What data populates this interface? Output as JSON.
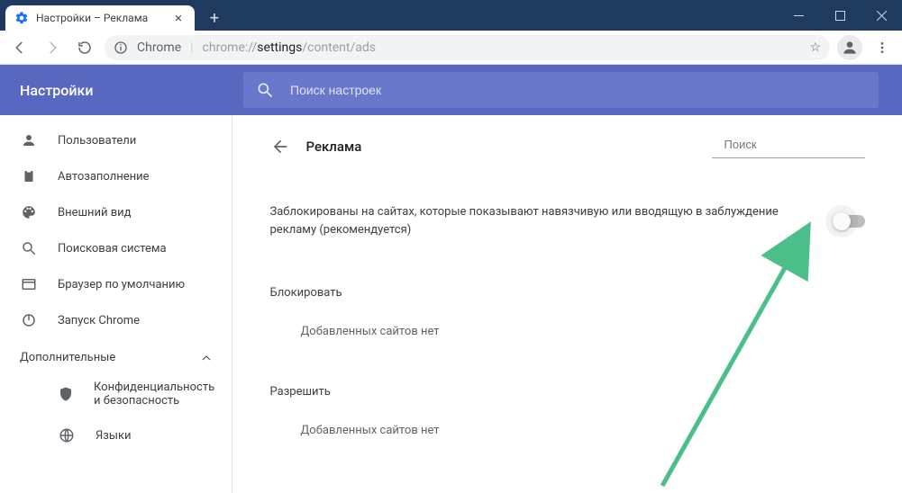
{
  "window": {
    "tab_title": "Настройки – Реклама"
  },
  "toolbar": {
    "chrome_label": "Chrome",
    "url_prefix": "chrome://",
    "url_bold": "settings",
    "url_suffix": "/content/ads"
  },
  "band": {
    "title": "Настройки",
    "search_placeholder": "Поиск настроек"
  },
  "sidebar": {
    "items": [
      {
        "label": "Пользователи"
      },
      {
        "label": "Автозаполнение"
      },
      {
        "label": "Внешний вид"
      },
      {
        "label": "Поисковая система"
      },
      {
        "label": "Браузер по умолчанию"
      },
      {
        "label": "Запуск Chrome"
      }
    ],
    "advanced_label": "Дополнительные",
    "advanced_items": [
      {
        "label": "Конфиденциальность и безопасность"
      },
      {
        "label": "Языки"
      }
    ]
  },
  "content": {
    "title": "Реклама",
    "search_placeholder": "Поиск",
    "toggle_desc": "Заблокированы на сайтах, которые показывают навязчивую или вводящую в заблуждение рекламу (рекомендуется)",
    "block_title": "Блокировать",
    "block_empty": "Добавленных сайтов нет",
    "allow_title": "Разрешить",
    "allow_empty": "Добавленных сайтов нет"
  }
}
